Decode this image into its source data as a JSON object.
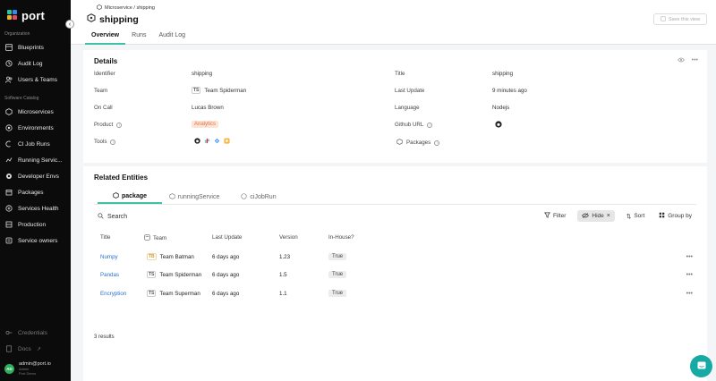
{
  "brand": {
    "name": "port"
  },
  "sidebar": {
    "organization_label": "Organization",
    "organization_items": [
      {
        "label": "Blueprints",
        "icon": "blueprint-icon"
      },
      {
        "label": "Audit Log",
        "icon": "history-icon"
      },
      {
        "label": "Users & Teams",
        "icon": "users-icon"
      }
    ],
    "catalog_label": "Software Catalog",
    "catalog_items": [
      {
        "label": "Microservices",
        "icon": "microservice-icon"
      },
      {
        "label": "Environments",
        "icon": "environment-icon"
      },
      {
        "label": "CI Job Runs",
        "icon": "ci-icon"
      },
      {
        "label": "Running Servic...",
        "icon": "running-service-icon"
      },
      {
        "label": "Developer Envs",
        "icon": "dev-env-icon"
      },
      {
        "label": "Packages",
        "icon": "package-icon"
      },
      {
        "label": "Services Health",
        "icon": "health-icon"
      },
      {
        "label": "Production",
        "icon": "production-icon"
      },
      {
        "label": "Service owners",
        "icon": "owners-icon"
      }
    ],
    "footer_items": [
      {
        "label": "Credentials",
        "icon": "key-icon"
      },
      {
        "label": "Docs",
        "icon": "docs-icon"
      }
    ],
    "user": {
      "initials": "AD",
      "email": "admin@port.io",
      "sub1": "Admin",
      "sub2": "Port Demo"
    }
  },
  "header": {
    "breadcrumb": "Microservice / shipping",
    "title": "shipping",
    "save_view": "Save this view",
    "tabs": [
      "Overview",
      "Runs",
      "Audit Log"
    ]
  },
  "details": {
    "title": "Details",
    "identifier_label": "Identifier",
    "identifier": "shipping",
    "team_label": "Team",
    "team_initials": "TS",
    "team": "Team Spiderman",
    "oncall_label": "On Call",
    "oncall": "Lucas Brown",
    "product_label": "Product",
    "product": "Analytics",
    "tools_label": "Tools",
    "title_label": "Title",
    "title_value": "shipping",
    "last_update_label": "Last Update",
    "last_update": "9 minutes ago",
    "language_label": "Language",
    "language": "Nodejs",
    "github_label": "Github URL",
    "packages_label": "Packages"
  },
  "related": {
    "title": "Related Entities",
    "tabs": [
      "package",
      "runningService",
      "ciJobRun"
    ],
    "search_placeholder": "Search",
    "toolbar": {
      "filter": "Filter",
      "hide": "Hide",
      "sort": "Sort",
      "group": "Group by"
    },
    "columns": [
      "Title",
      "Team",
      "Last Update",
      "Version",
      "In-House?"
    ],
    "rows": [
      {
        "title": "Numpy",
        "team_initials": "TB",
        "team": "Team Batman",
        "last_update": "6 days ago",
        "version": "1.23",
        "in_house": "True"
      },
      {
        "title": "Pandas",
        "team_initials": "TS",
        "team": "Team Spiderman",
        "last_update": "6 days ago",
        "version": "1.5",
        "in_house": "True"
      },
      {
        "title": "Encryption",
        "team_initials": "TS",
        "team": "Team Superman",
        "last_update": "6 days ago",
        "version": "1.1",
        "in_house": "True"
      }
    ],
    "results": "3 results"
  },
  "colors": {
    "accent": "#3fc1a8",
    "link": "#2a6fd1",
    "chat": "#17a9a4",
    "tag_bg": "#fde5d6",
    "tag_fg": "#e2744b"
  }
}
